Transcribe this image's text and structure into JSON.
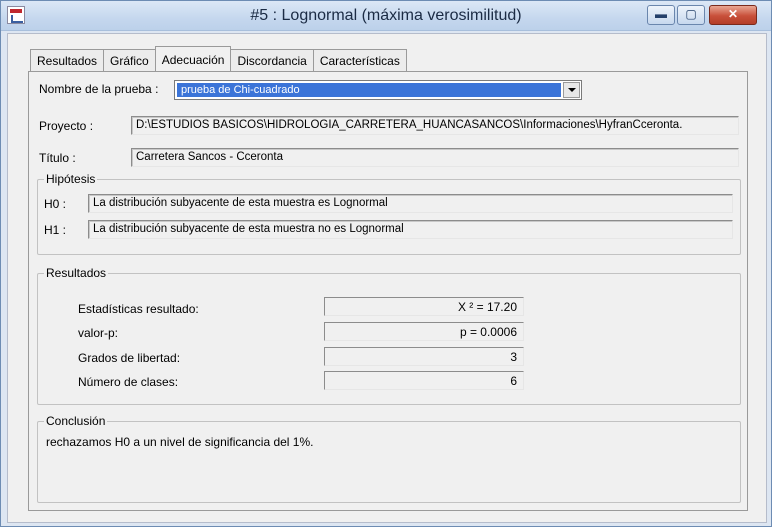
{
  "window": {
    "title": "#5 : Lognormal (máxima verosimilitud)",
    "close_glyph": "✕",
    "min_glyph": "▬",
    "max_glyph": "▢"
  },
  "tabs": [
    "Resultados",
    "Gráfico",
    "Adecuación",
    "Discordancia",
    "Características"
  ],
  "active_tab": "Adecuación",
  "test": {
    "label": "Nombre de la prueba :",
    "value": "prueba de Chi-cuadrado"
  },
  "project": {
    "label": "Proyecto :",
    "value": "D:\\ESTUDIOS BASICOS\\HIDROLOGIA_CARRETERA_HUANCASANCOS\\Informaciones\\HyfranCceronta."
  },
  "titulo": {
    "label": "Título :",
    "value": "Carretera Sancos - Cceronta"
  },
  "hipotesis": {
    "title": "Hipótesis",
    "h0_label": "H0 :",
    "h0_value": "La distribución subyacente de esta muestra es Lognormal",
    "h1_label": "H1 :",
    "h1_value": "La distribución subyacente de esta muestra no es Lognormal"
  },
  "resultados": {
    "title": "Resultados",
    "rows": [
      {
        "label": "Estadísticas resultado:",
        "value": "X ² = 17.20"
      },
      {
        "label": "valor-p:",
        "value": "p = 0.0006"
      },
      {
        "label": "Grados de libertad:",
        "value": "3"
      },
      {
        "label": "Número de clases:",
        "value": "6"
      }
    ]
  },
  "conclusion": {
    "title": "Conclusión",
    "text": "rechazamos H0 a un nivel de significancia del 1%."
  }
}
